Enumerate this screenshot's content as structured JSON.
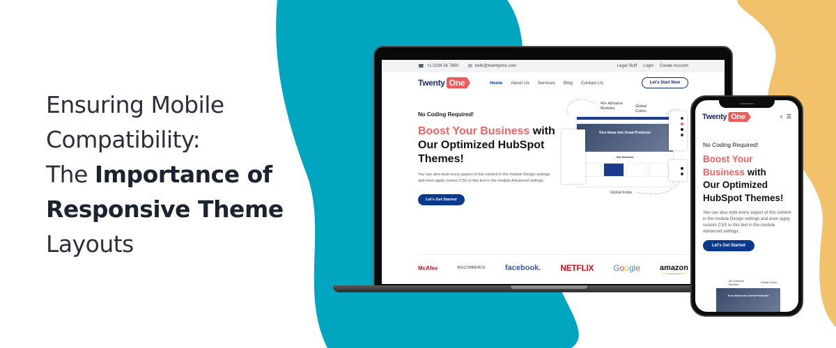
{
  "colors": {
    "teal_blob": "#00a5bf",
    "yellow_blob": "#f2c16b",
    "brand_red": "#f05a5a",
    "brand_navy": "#0b3a8c"
  },
  "hero": {
    "line1": "Ensuring Mobile",
    "line2": "Compatibility:",
    "line3_light": "The ",
    "line3_bold": "Importance of",
    "line4_bold": "Responsive Theme",
    "line5": "Layouts"
  },
  "site": {
    "topbar": {
      "phone": "+1 0234 56 7890",
      "email": "hello@twentyone.com",
      "links": [
        "Legal Stuff",
        "Login",
        "Create Account"
      ]
    },
    "logo": {
      "word": "Twenty",
      "badge": "One"
    },
    "nav": [
      "Home",
      "About Us",
      "Services",
      "Blog",
      "Contact Us"
    ],
    "nav_active": "Home",
    "nav_cta": "Let's Start Now",
    "kicker": "No Coding Required!",
    "title_accent": "Boost Your Business",
    "title_rest": "with Our Optimized HubSpot Themes!",
    "body": "You can also style every aspect of this content in the module Design settings and even apply custom CSS to this text in the module Advanced settings.",
    "cta": "Let's Get Started",
    "preview": {
      "modules_label": "40+ Advance Modules",
      "colors_label": "Global Colors",
      "fonts_label": "Global Fonts",
      "hero_text": "Turn Ideas into Great Products!",
      "services_heading": "Our Services"
    },
    "brands": [
      "McAfee",
      "BIGCOMMERCE",
      "facebook.",
      "NETFLIX",
      "Google",
      "amazon"
    ]
  },
  "phone": {
    "title_accent_1": "Boost Your",
    "title_accent_2": "Business",
    "title_rest_1": " with",
    "title_rest_2": "Our Optimized HubSpot Themes!"
  },
  "icons": {
    "phone": "☎",
    "email": "✉",
    "search": "⌕",
    "menu": "☰"
  }
}
